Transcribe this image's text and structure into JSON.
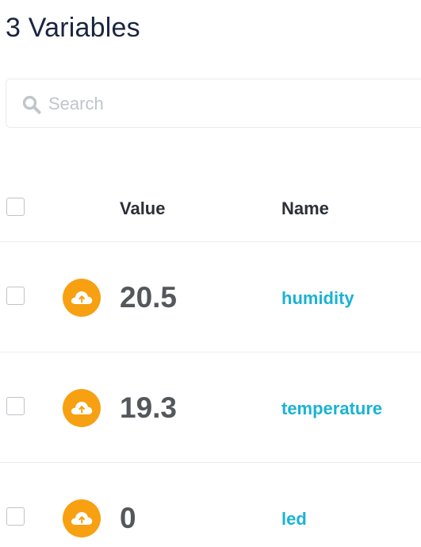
{
  "header": {
    "title": "3 Variables"
  },
  "search": {
    "placeholder": "Search",
    "value": "",
    "icon": "search-icon"
  },
  "table": {
    "columns": {
      "value": "Value",
      "name": "Name"
    },
    "rows": [
      {
        "value": "20.5",
        "name": "humidity",
        "icon": "cloud-upload-icon"
      },
      {
        "value": "19.3",
        "name": "temperature",
        "icon": "cloud-upload-icon"
      },
      {
        "value": "0",
        "name": "led",
        "icon": "cloud-upload-icon"
      }
    ]
  },
  "colors": {
    "title": "#1b2540",
    "badge": "#f7a012",
    "name_link": "#1ab3d3",
    "value_text": "#54575c"
  }
}
